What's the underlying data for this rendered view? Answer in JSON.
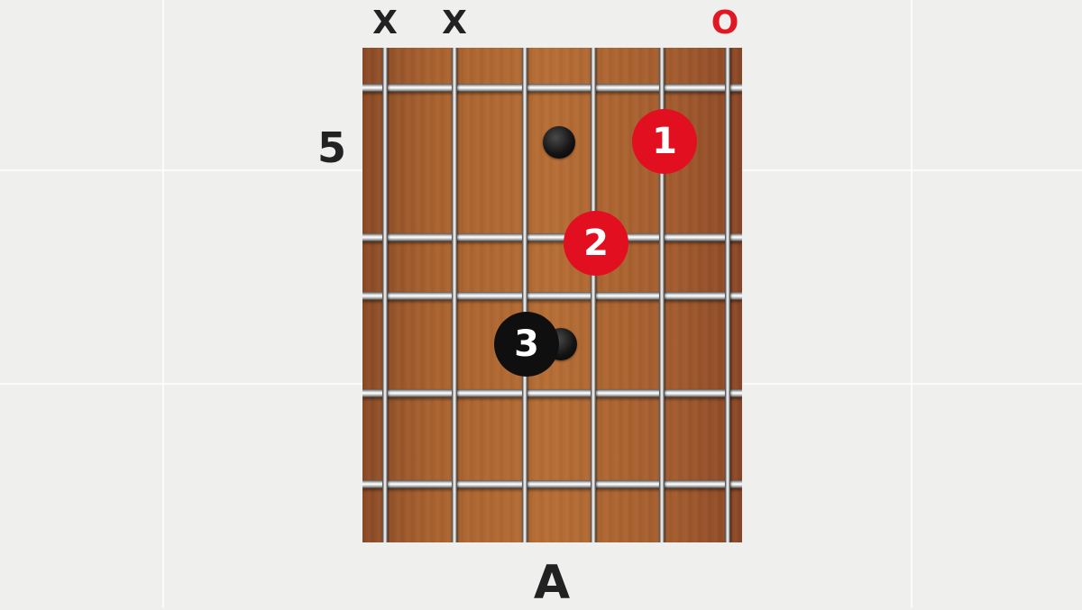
{
  "colors": {
    "muted": "#222222",
    "open": "#e01823",
    "finger_red": "#e10f1f",
    "finger_black": "#0f0f0f",
    "wood": "#b06a34"
  },
  "chord": {
    "name": "A",
    "start_fret": "5",
    "string_markers": [
      "X",
      "X",
      "",
      "",
      "",
      "O"
    ],
    "fingers": [
      {
        "label": "1",
        "string": 5,
        "fret": 1,
        "color": "red"
      },
      {
        "label": "2",
        "string": 4,
        "fret": 2,
        "color": "red"
      },
      {
        "label": "3",
        "string": 3,
        "fret": 3,
        "color": "black"
      }
    ],
    "inlays": [
      {
        "string_gap": "3-4",
        "fret": 1
      },
      {
        "string_gap": "3-4",
        "fret": 3
      }
    ]
  }
}
